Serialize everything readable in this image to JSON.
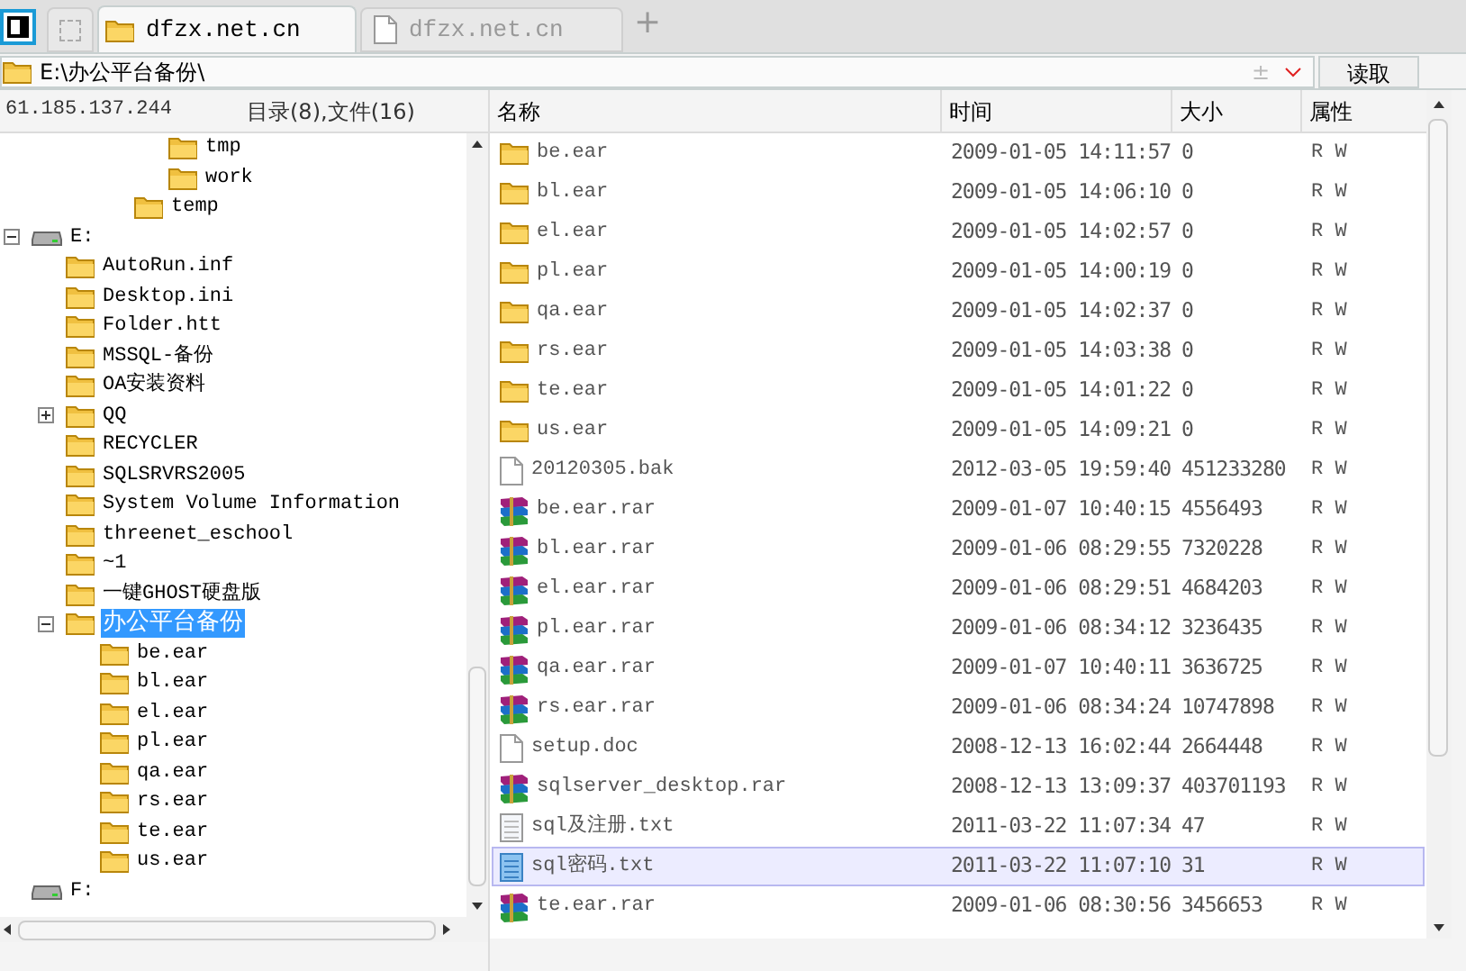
{
  "tabs": [
    {
      "label": "dfzx.net.cn",
      "kind": "folder",
      "selected": true
    },
    {
      "label": "dfzx.net.cn",
      "kind": "doc",
      "selected": false
    }
  ],
  "new_tab": "+",
  "address": {
    "path": "E:\\办公平台备份\\",
    "clear_icon": "±",
    "button": "读取"
  },
  "left_panel": {
    "host": "61.185.137.244",
    "summary": "目录(8),文件(16)"
  },
  "tree": [
    {
      "children": [
        {
          "children": [
            {
              "children": [
                {
                  "children": [
                    {
                      "label": "tmp",
                      "kind": "folder",
                      "selected": false
                    },
                    {
                      "label": "work",
                      "kind": "folder",
                      "selected": false
                    }
                  ]
                },
                {
                  "label": "temp",
                  "kind": "folder",
                  "selected": false
                }
              ]
            }
          ]
        }
      ]
    },
    {
      "label": "E:",
      "kind": "drive",
      "expanded": true,
      "selected": false,
      "children": [
        {
          "label": "AutoRun.inf",
          "kind": "folder",
          "selected": false
        },
        {
          "label": "Desktop.ini",
          "kind": "folder",
          "selected": false
        },
        {
          "label": "Folder.htt",
          "kind": "folder",
          "selected": false
        },
        {
          "label": "MSSQL-备份",
          "kind": "folder",
          "selected": false
        },
        {
          "label": "OA安装资料",
          "kind": "folder",
          "selected": false
        },
        {
          "label": "QQ",
          "kind": "folder",
          "expanded": false,
          "selected": false
        },
        {
          "label": "RECYCLER",
          "kind": "folder",
          "selected": false
        },
        {
          "label": "SQLSRVRS2005",
          "kind": "folder",
          "selected": false
        },
        {
          "label": "System Volume Information",
          "kind": "folder",
          "selected": false
        },
        {
          "label": "threenet_eschool",
          "kind": "folder",
          "selected": false
        },
        {
          "label": "~1",
          "kind": "folder",
          "selected": false
        },
        {
          "label": "一键GHOST硬盘版",
          "kind": "folder",
          "selected": false
        },
        {
          "label": "办公平台备份",
          "kind": "folder",
          "expanded": true,
          "selected": true,
          "children": [
            {
              "label": "be.ear",
              "kind": "folder",
              "selected": false
            },
            {
              "label": "bl.ear",
              "kind": "folder",
              "selected": false
            },
            {
              "label": "el.ear",
              "kind": "folder",
              "selected": false
            },
            {
              "label": "pl.ear",
              "kind": "folder",
              "selected": false
            },
            {
              "label": "qa.ear",
              "kind": "folder",
              "selected": false
            },
            {
              "label": "rs.ear",
              "kind": "folder",
              "selected": false
            },
            {
              "label": "te.ear",
              "kind": "folder",
              "selected": false
            },
            {
              "label": "us.ear",
              "kind": "folder",
              "selected": false
            }
          ]
        }
      ]
    },
    {
      "label": "F:",
      "kind": "drive",
      "selected": false
    }
  ],
  "table": {
    "columns": [
      "名称",
      "时间",
      "大小",
      "属性"
    ],
    "rows": [
      {
        "kind": "folder",
        "name": "be.ear",
        "time": "2009-01-05 14:11:57",
        "size": "0",
        "attr": "R W",
        "selected": false
      },
      {
        "kind": "folder",
        "name": "bl.ear",
        "time": "2009-01-05 14:06:10",
        "size": "0",
        "attr": "R W",
        "selected": false
      },
      {
        "kind": "folder",
        "name": "el.ear",
        "time": "2009-01-05 14:02:57",
        "size": "0",
        "attr": "R W",
        "selected": false
      },
      {
        "kind": "folder",
        "name": "pl.ear",
        "time": "2009-01-05 14:00:19",
        "size": "0",
        "attr": "R W",
        "selected": false
      },
      {
        "kind": "folder",
        "name": "qa.ear",
        "time": "2009-01-05 14:02:37",
        "size": "0",
        "attr": "R W",
        "selected": false
      },
      {
        "kind": "folder",
        "name": "rs.ear",
        "time": "2009-01-05 14:03:38",
        "size": "0",
        "attr": "R W",
        "selected": false
      },
      {
        "kind": "folder",
        "name": "te.ear",
        "time": "2009-01-05 14:01:22",
        "size": "0",
        "attr": "R W",
        "selected": false
      },
      {
        "kind": "folder",
        "name": "us.ear",
        "time": "2009-01-05 14:09:21",
        "size": "0",
        "attr": "R W",
        "selected": false
      },
      {
        "kind": "doc",
        "name": "20120305.bak",
        "time": "2012-03-05 19:59:40",
        "size": "451233280",
        "attr": "R W",
        "selected": false
      },
      {
        "kind": "rar",
        "name": "be.ear.rar",
        "time": "2009-01-07 10:40:15",
        "size": "4556493",
        "attr": "R W",
        "selected": false
      },
      {
        "kind": "rar",
        "name": "bl.ear.rar",
        "time": "2009-01-06 08:29:55",
        "size": "7320228",
        "attr": "R W",
        "selected": false
      },
      {
        "kind": "rar",
        "name": "el.ear.rar",
        "time": "2009-01-06 08:29:51",
        "size": "4684203",
        "attr": "R W",
        "selected": false
      },
      {
        "kind": "rar",
        "name": "pl.ear.rar",
        "time": "2009-01-06 08:34:12",
        "size": "3236435",
        "attr": "R W",
        "selected": false
      },
      {
        "kind": "rar",
        "name": "qa.ear.rar",
        "time": "2009-01-07 10:40:11",
        "size": "3636725",
        "attr": "R W",
        "selected": false
      },
      {
        "kind": "rar",
        "name": "rs.ear.rar",
        "time": "2009-01-06 08:34:24",
        "size": "10747898",
        "attr": "R W",
        "selected": false
      },
      {
        "kind": "doc",
        "name": "setup.doc",
        "time": "2008-12-13 16:02:44",
        "size": "2664448",
        "attr": "R W",
        "selected": false
      },
      {
        "kind": "rar",
        "name": "sqlserver_desktop.rar",
        "time": "2008-12-13 13:09:37",
        "size": "403701193",
        "attr": "R W",
        "selected": false
      },
      {
        "kind": "txt",
        "name": "sql及注册.txt",
        "time": "2011-03-22 11:07:34",
        "size": "47",
        "attr": "R W",
        "selected": false
      },
      {
        "kind": "txt",
        "name": "sql密码.txt",
        "time": "2011-03-22 11:07:10",
        "size": "31",
        "attr": "R W",
        "selected": true
      },
      {
        "kind": "rar",
        "name": "te.ear.rar",
        "time": "2009-01-06 08:30:56",
        "size": "3456653",
        "attr": "R W",
        "selected": false
      }
    ]
  }
}
